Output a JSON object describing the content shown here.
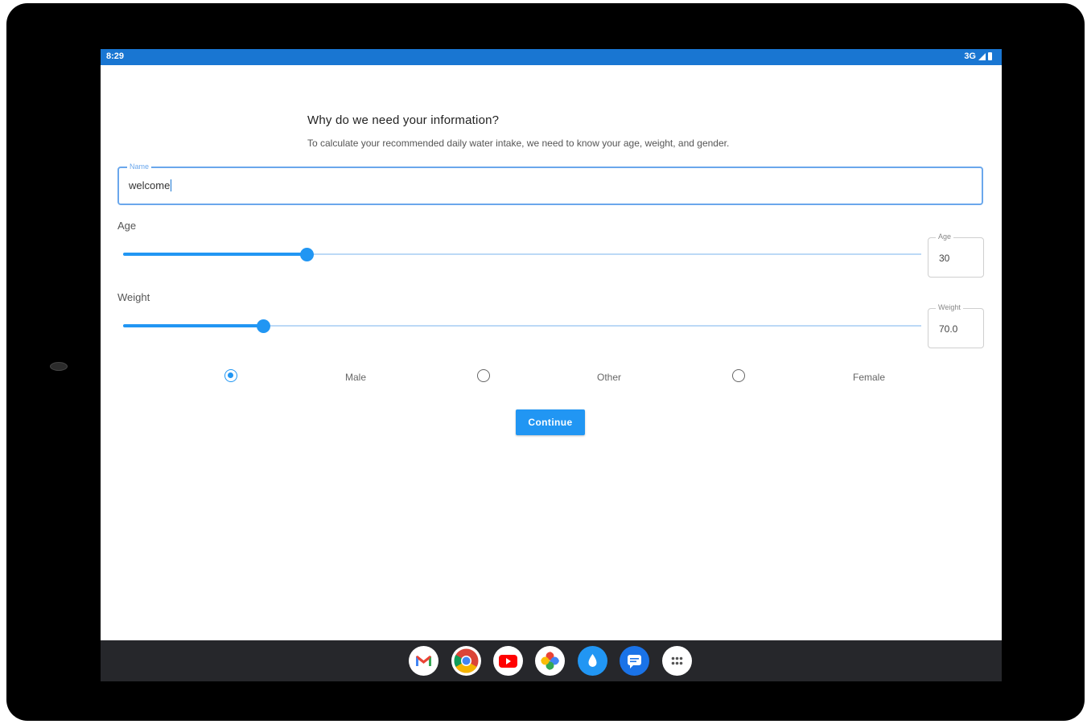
{
  "status_bar": {
    "time": "8:29",
    "network": "3G"
  },
  "form": {
    "heading": "Why do we need your information?",
    "subtext": "To calculate your recommended daily water intake, we need to know your age, weight, and gender.",
    "name_field": {
      "label": "Name",
      "value": "welcome"
    },
    "age": {
      "label": "Age",
      "box_label": "Age",
      "value": "30",
      "slider_fraction": 0.23
    },
    "weight": {
      "label": "Weight",
      "box_label": "Weight",
      "value": "70.0",
      "slider_fraction": 0.175
    },
    "gender_options": [
      {
        "label": "Male",
        "selected": true
      },
      {
        "label": "Other",
        "selected": false
      },
      {
        "label": "Female",
        "selected": false
      }
    ],
    "continue_label": "Continue"
  },
  "taskbar": {
    "apps": [
      "gmail-icon",
      "chrome-icon",
      "youtube-icon",
      "photos-icon",
      "water-drop-icon",
      "messages-icon",
      "app-launcher-icon"
    ]
  },
  "colors": {
    "accent": "#2196f3",
    "status_bar": "#1976d2",
    "taskbar": "#26272b"
  }
}
